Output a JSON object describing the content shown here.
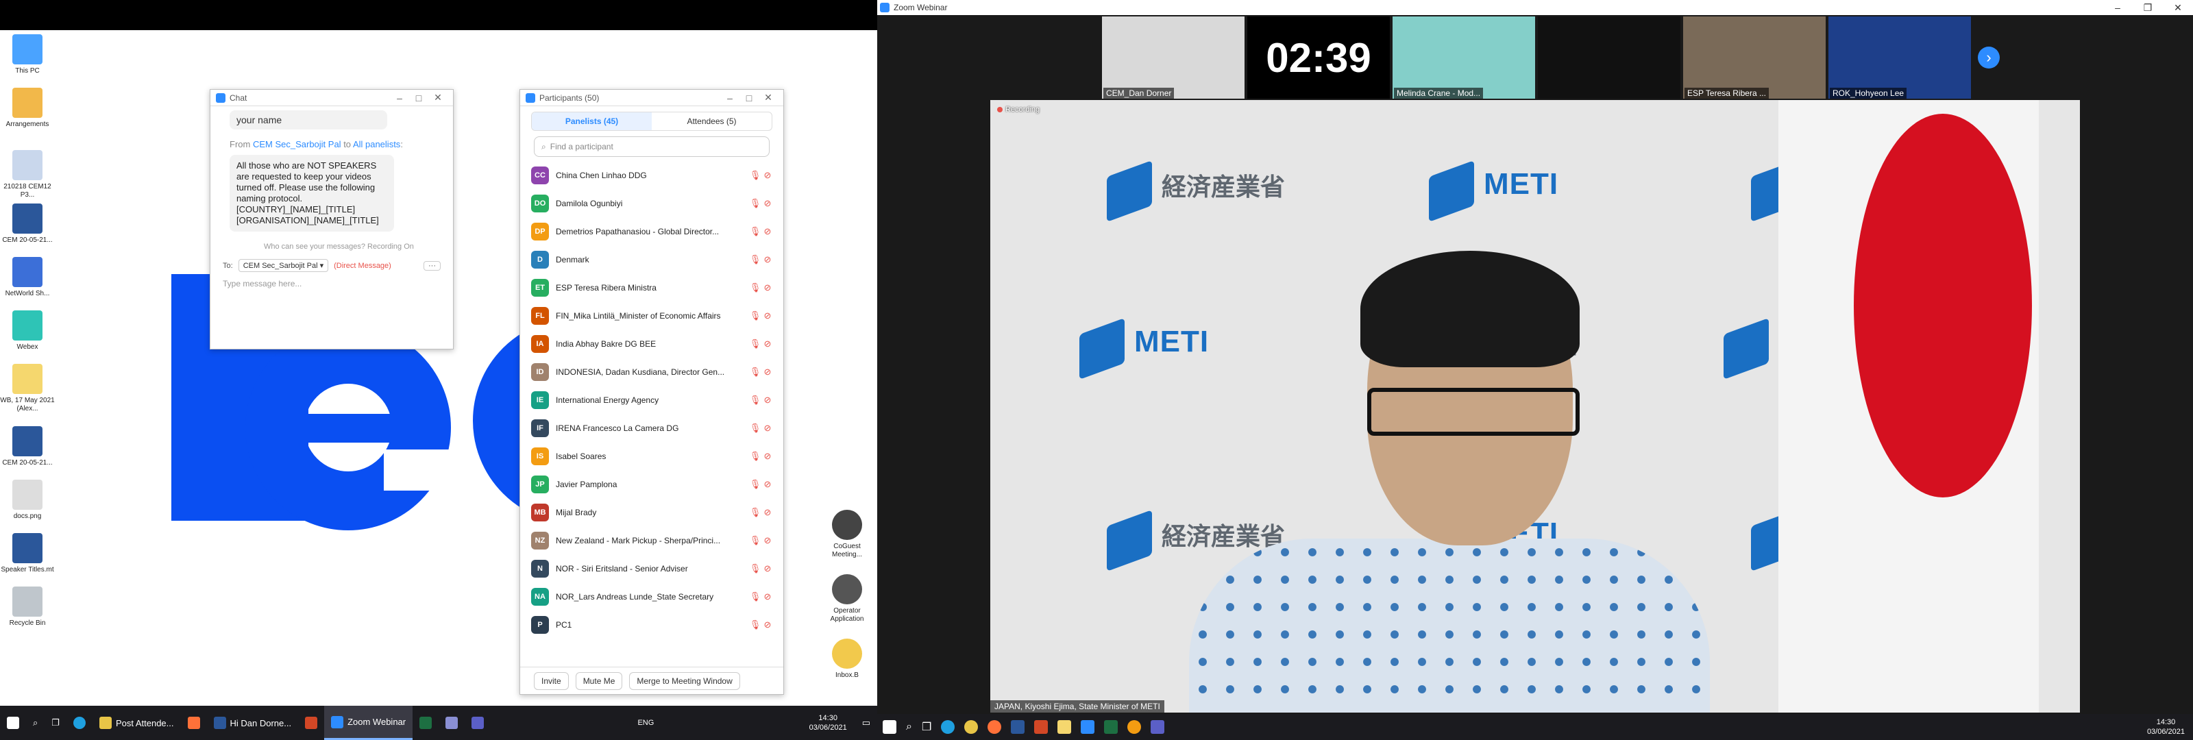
{
  "desktop": {
    "icons": [
      {
        "label": "This PC",
        "color": "#4aa3ff"
      },
      {
        "label": "Arrangements",
        "color": "#f2b84a"
      },
      {
        "label": "210218 CEM12 P3...",
        "color": "#c9d7ec"
      },
      {
        "label": "CEM 20-05-21...",
        "color": "#2b579a"
      },
      {
        "label": "NetWorld Sh...",
        "color": "#3c6fd8"
      },
      {
        "label": "Webex",
        "color": "#2ec4b6"
      },
      {
        "label": "WB, 17 May 2021 (Alex...",
        "color": "#f5d76e"
      },
      {
        "label": "CEM 20-05-21...",
        "color": "#2b579a"
      },
      {
        "label": "docs.png",
        "color": "#dddddd"
      },
      {
        "label": "Speaker Titles.mt",
        "color": "#2b579a"
      },
      {
        "label": "Recycle Bin",
        "color": "#bfc6cc"
      }
    ],
    "right_icons": [
      {
        "label": "CoGuest Meeting...",
        "color": "#444444"
      },
      {
        "label": "Operator Application",
        "color": "#555555"
      },
      {
        "label": "Inbox.B",
        "color": "#f2c94c"
      }
    ]
  },
  "chat": {
    "title": "Chat",
    "name_bubble": "your name",
    "from_prefix": "From ",
    "from_sender": "CEM Sec_Sarbojit Pal",
    "from_to": " to ",
    "from_recipient": "All panelists",
    "from_suffix": ":",
    "message": "All those who are NOT SPEAKERS are requested to keep your videos turned off. Please use the following naming protocol. [COUNTRY]_[NAME]_[TITLE] [ORGANISATION]_[NAME]_[TITLE]",
    "who_can_see": "Who can see your messages? Recording On",
    "to_label": "To:",
    "to_value": "CEM Sec_Sarbojit Pal ▾",
    "direct": "(Direct Message)",
    "more": "···",
    "input_placeholder": "Type message here..."
  },
  "participants": {
    "title": "Participants (50)",
    "tab_panelists": "Panelists (45)",
    "tab_attendees": "Attendees (5)",
    "find_placeholder": "Find a participant",
    "list": [
      {
        "initials": "CC",
        "name": "China Chen Linhao DDG",
        "color": "#8e44ad"
      },
      {
        "initials": "DO",
        "name": "Damilola Ogunbiyi",
        "color": "#27ae60"
      },
      {
        "initials": "DP",
        "name": "Demetrios Papathanasiou - Global Director...",
        "color": "#f39c12"
      },
      {
        "initials": "D",
        "name": "Denmark",
        "color": "#2980b9"
      },
      {
        "initials": "ET",
        "name": "ESP Teresa Ribera Ministra",
        "color": "#27ae60"
      },
      {
        "initials": "FL",
        "name": "FIN_Mika Lintilä_Minister of Economic Affairs",
        "color": "#d35400"
      },
      {
        "initials": "IA",
        "name": "India Abhay Bakre DG BEE",
        "color": "#d35400"
      },
      {
        "initials": "ID",
        "name": "INDONESIA, Dadan Kusdiana, Director Gen...",
        "color": "#a0826d"
      },
      {
        "initials": "IE",
        "name": "International Energy Agency",
        "color": "#16a085"
      },
      {
        "initials": "IF",
        "name": "IRENA Francesco La Camera DG",
        "color": "#34495e"
      },
      {
        "initials": "IS",
        "name": "Isabel Soares",
        "color": "#f39c12"
      },
      {
        "initials": "JP",
        "name": "Javier Pamplona",
        "color": "#27ae60"
      },
      {
        "initials": "MB",
        "name": "Mijal Brady",
        "color": "#c0392b"
      },
      {
        "initials": "NZ",
        "name": "New Zealand - Mark Pickup - Sherpa/Princi...",
        "color": "#a0826d"
      },
      {
        "initials": "N",
        "name": "NOR - Siri Eritsland - Senior Adviser",
        "color": "#34495e"
      },
      {
        "initials": "NA",
        "name": "NOR_Lars Andreas Lunde_State Secretary",
        "color": "#16a085"
      },
      {
        "initials": "P",
        "name": "PC1",
        "color": "#2c3e50"
      }
    ],
    "btn_invite": "Invite",
    "btn_mute": "Mute Me",
    "btn_merge": "Merge to Meeting Window"
  },
  "left_taskbar": {
    "apps": [
      {
        "label": "Post Attende...",
        "color": "#e8c547"
      },
      {
        "label": "",
        "color": "#ff7139"
      },
      {
        "label": "Hi Dan Dorne...",
        "color": "#2b579a"
      },
      {
        "label": "",
        "color": "#d24726"
      },
      {
        "label": "Zoom Webinar",
        "color": "#2d8cff"
      },
      {
        "label": "",
        "color": "#1d6f42"
      },
      {
        "label": "",
        "color": "#8a8fd4"
      },
      {
        "label": "",
        "color": "#5b5fc7"
      }
    ],
    "lang": "ENG",
    "time": "14:30",
    "date": "03/06/2021"
  },
  "zoom": {
    "title": "Zoom Webinar",
    "timer": "02:39",
    "tiles": [
      {
        "name": "CEM_Dan Dorner",
        "bg": "#d9d9d9"
      },
      {
        "name": "Melinda Crane - Mod...",
        "bg": "#84cfc9"
      },
      {
        "name": "",
        "bg": "#111111"
      },
      {
        "name": "ESP Teresa Ribera ...",
        "bg": "#7a6a58"
      },
      {
        "name": "ROK_Hohyeon Lee",
        "bg": "#1e3f8a"
      }
    ],
    "recording": "Recording",
    "speaker": "JAPAN, Kiyoshi Ejima, State Minister of METI",
    "bg_text_jp": "経済産業省",
    "bg_text_meti": "METI",
    "time": "14:30",
    "date": "03/06/2021"
  }
}
